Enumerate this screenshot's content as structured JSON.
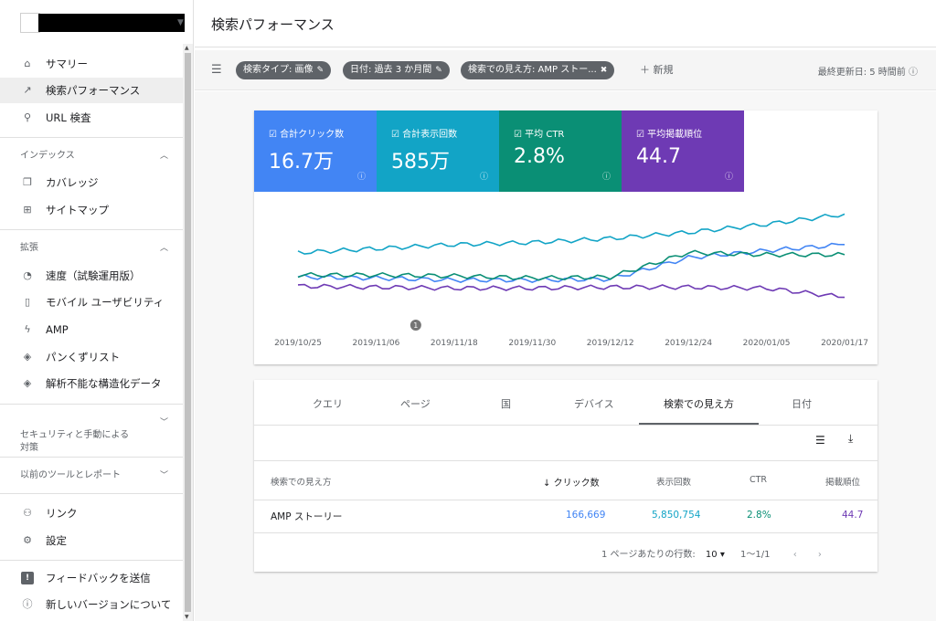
{
  "property": {},
  "sidebar": {
    "items_top": [
      {
        "label": "サマリー",
        "icon": "home-icon",
        "glyph": "⌂"
      },
      {
        "label": "検索パフォーマンス",
        "icon": "trending-up-icon",
        "glyph": "↗"
      },
      {
        "label": "URL 検査",
        "icon": "search-icon",
        "glyph": "⚲"
      }
    ],
    "section_index": "インデックス",
    "items_index": [
      {
        "label": "カバレッジ",
        "icon": "file-copy-icon",
        "glyph": "❐"
      },
      {
        "label": "サイトマップ",
        "icon": "sitemap-icon",
        "glyph": "⊞"
      }
    ],
    "section_enh": "拡張",
    "items_enh": [
      {
        "label": "速度（試験運用版）",
        "icon": "speed-gauge-icon",
        "glyph": "◔"
      },
      {
        "label": "モバイル ユーザビリティ",
        "icon": "smartphone-icon",
        "glyph": "▯"
      },
      {
        "label": "AMP",
        "icon": "amp-bolt-icon",
        "glyph": "ϟ"
      },
      {
        "label": "パンくずリスト",
        "icon": "layers-icon",
        "glyph": "◈"
      },
      {
        "label": "解析不能な構造化データ",
        "icon": "layers-icon-2",
        "glyph": "◈"
      }
    ],
    "section_security": "セキュリティと手動による\n対策",
    "section_legacy": "以前のツールとレポート",
    "items_bottom": [
      {
        "label": "リンク",
        "icon": "links-icon",
        "glyph": "⚇"
      },
      {
        "label": "設定",
        "icon": "settings-gear-icon",
        "glyph": "⚙"
      }
    ],
    "items_footer": [
      {
        "label": "フィードバックを送信",
        "icon": "feedback-icon",
        "glyph": "!"
      },
      {
        "label": "新しいバージョンについて",
        "icon": "info-icon",
        "glyph": "ⓘ"
      }
    ]
  },
  "header": {
    "title": "検索パフォーマンス"
  },
  "filters": {
    "chips": [
      {
        "label": "検索タイプ: 画像",
        "icon": "✎"
      },
      {
        "label": "日付: 過去 3 か月間",
        "icon": "✎"
      },
      {
        "label": "検索での見え方: AMP ストー...",
        "icon": "✖"
      }
    ],
    "new_label": "新規",
    "updated": "最終更新日: 5 時間前"
  },
  "metrics": [
    {
      "label": "合計クリック数",
      "value": "16.7万",
      "color": "#4285f4"
    },
    {
      "label": "合計表示回数",
      "value": "585万",
      "color": "#12a4c6"
    },
    {
      "label": "平均 CTR",
      "value": "2.8%",
      "color": "#0a8f75"
    },
    {
      "label": "平均掲載順位",
      "value": "44.7",
      "color": "#6e3ab4"
    }
  ],
  "chart_data": {
    "type": "line",
    "x": [
      "2019/10/25",
      "2019/11/06",
      "2019/11/18",
      "2019/11/30",
      "2019/12/12",
      "2019/12/24",
      "2020/01/05",
      "2020/01/17"
    ],
    "annotation": "1",
    "series": [
      {
        "name": "合計クリック数",
        "color": "#4285f4",
        "values": [
          64,
          63,
          61,
          61,
          62,
          83,
          90,
          96
        ]
      },
      {
        "name": "合計表示回数",
        "color": "#12a4c6",
        "values": [
          88,
          92,
          96,
          98,
          102,
          108,
          116,
          126
        ]
      },
      {
        "name": "平均 CTR",
        "color": "#0a8f75",
        "values": [
          66,
          66,
          65,
          63,
          64,
          88,
          86,
          86
        ]
      },
      {
        "name": "平均掲載順位",
        "color": "#6e3ab4",
        "values": [
          55,
          54,
          53,
          53,
          54,
          54,
          53,
          44
        ]
      }
    ]
  },
  "table": {
    "tabs": [
      "クエリ",
      "ページ",
      "国",
      "デバイス",
      "検索での見え方",
      "日付"
    ],
    "active_tab": "検索での見え方",
    "columns": {
      "name": "検索での見え方",
      "clicks": "クリック数",
      "impressions": "表示回数",
      "ctr": "CTR",
      "position": "掲載順位"
    },
    "sort_arrow": "↓",
    "row": {
      "name": "AMP ストーリー",
      "clicks": "166,669",
      "impressions": "5,850,754",
      "ctr": "2.8%",
      "position": "44.7"
    },
    "pager": {
      "rows_label": "1 ページあたりの行数:",
      "rows": "10",
      "range": "1〜1/1"
    }
  }
}
